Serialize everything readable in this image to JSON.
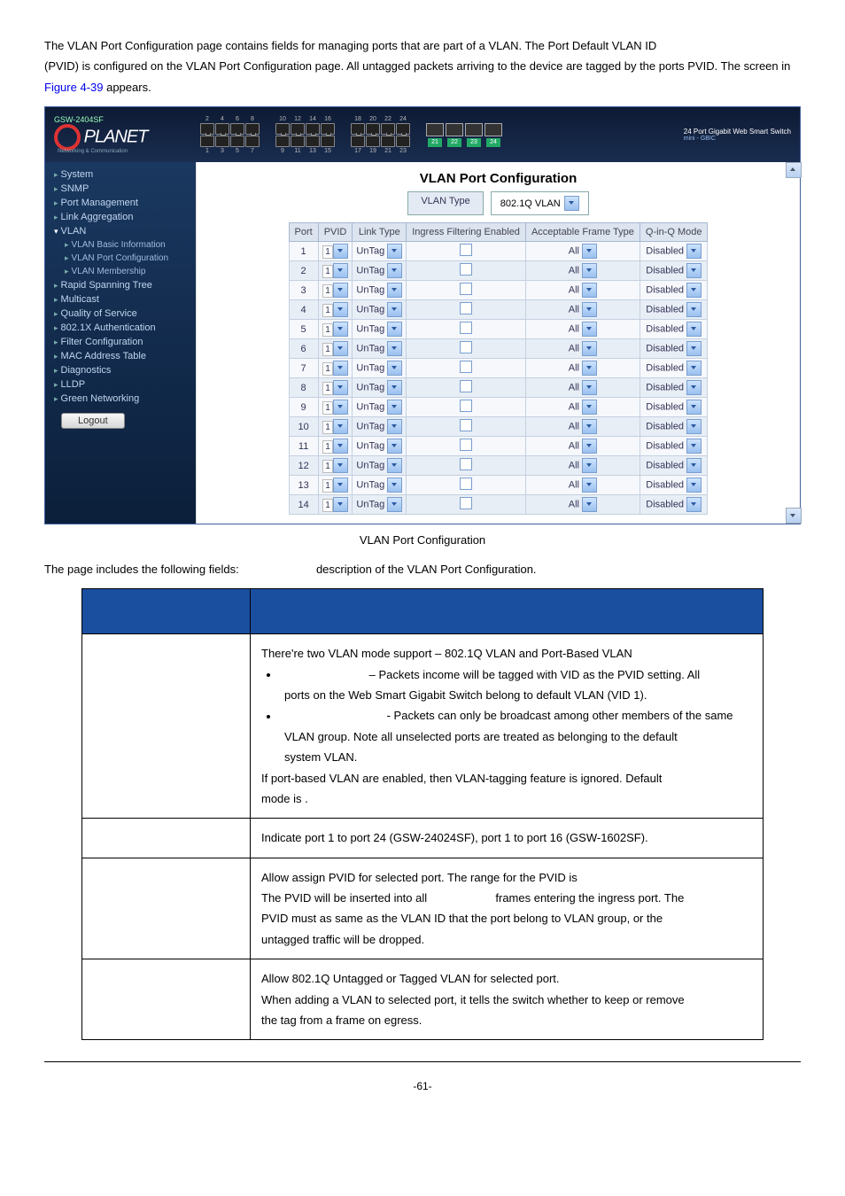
{
  "intro": {
    "p1": "The VLAN Port Configuration page contains fields for managing ports that are part of a VLAN. The Port Default VLAN ID",
    "p2a": "(PVID) is configured on the VLAN Port Configuration page. All untagged packets arriving to the device are tagged by the",
    "p2b": "ports PVID. The screen in ",
    "figlink": "Figure 4-39",
    "p2c": " appears."
  },
  "header": {
    "model": "GSW-2404SF",
    "brand": "PLANET",
    "brand_sub": "Networking & Communication",
    "title_r1": "24 Port Gigabit Web Smart Switch",
    "title_r2": "mini - GBIC",
    "top_port_nums": [
      "2",
      "4",
      "6",
      "8",
      "10",
      "12",
      "14",
      "16",
      "18",
      "20",
      "22",
      "24"
    ],
    "bot_port_nums": [
      "1",
      "3",
      "5",
      "7",
      "9",
      "11",
      "13",
      "15",
      "17",
      "19",
      "21",
      "23"
    ],
    "sfp_nums": [
      "21",
      "22",
      "23",
      "24"
    ]
  },
  "sidebar": {
    "items": [
      {
        "label": "System",
        "type": "top"
      },
      {
        "label": "SNMP",
        "type": "top"
      },
      {
        "label": "Port Management",
        "type": "top"
      },
      {
        "label": "Link Aggregation",
        "type": "top"
      },
      {
        "label": "VLAN",
        "type": "open"
      },
      {
        "label": "VLAN Basic Information",
        "type": "sub"
      },
      {
        "label": "VLAN Port Configuration",
        "type": "sub"
      },
      {
        "label": "VLAN Membership",
        "type": "sub"
      },
      {
        "label": "Rapid Spanning Tree",
        "type": "top"
      },
      {
        "label": "Multicast",
        "type": "top"
      },
      {
        "label": "Quality of Service",
        "type": "top"
      },
      {
        "label": "802.1X Authentication",
        "type": "top"
      },
      {
        "label": "Filter Configuration",
        "type": "top"
      },
      {
        "label": "MAC Address Table",
        "type": "top"
      },
      {
        "label": "Diagnostics",
        "type": "top"
      },
      {
        "label": "LLDP",
        "type": "top"
      },
      {
        "label": "Green Networking",
        "type": "top"
      }
    ],
    "logout": "Logout"
  },
  "main": {
    "title": "VLAN Port Configuration",
    "vlan_type_label": "VLAN Type",
    "vlan_type_value": "802.1Q VLAN",
    "columns": [
      "Port",
      "PVID",
      "Link Type",
      "Ingress Filtering Enabled",
      "Acceptable Frame Type",
      "Q-in-Q Mode"
    ],
    "rows": [
      {
        "port": "1",
        "pvid": "1",
        "link": "UnTag",
        "aft": "All",
        "qinq": "Disabled"
      },
      {
        "port": "2",
        "pvid": "1",
        "link": "UnTag",
        "aft": "All",
        "qinq": "Disabled"
      },
      {
        "port": "3",
        "pvid": "1",
        "link": "UnTag",
        "aft": "All",
        "qinq": "Disabled"
      },
      {
        "port": "4",
        "pvid": "1",
        "link": "UnTag",
        "aft": "All",
        "qinq": "Disabled"
      },
      {
        "port": "5",
        "pvid": "1",
        "link": "UnTag",
        "aft": "All",
        "qinq": "Disabled"
      },
      {
        "port": "6",
        "pvid": "1",
        "link": "UnTag",
        "aft": "All",
        "qinq": "Disabled"
      },
      {
        "port": "7",
        "pvid": "1",
        "link": "UnTag",
        "aft": "All",
        "qinq": "Disabled"
      },
      {
        "port": "8",
        "pvid": "1",
        "link": "UnTag",
        "aft": "All",
        "qinq": "Disabled"
      },
      {
        "port": "9",
        "pvid": "1",
        "link": "UnTag",
        "aft": "All",
        "qinq": "Disabled"
      },
      {
        "port": "10",
        "pvid": "1",
        "link": "UnTag",
        "aft": "All",
        "qinq": "Disabled"
      },
      {
        "port": "11",
        "pvid": "1",
        "link": "UnTag",
        "aft": "All",
        "qinq": "Disabled"
      },
      {
        "port": "12",
        "pvid": "1",
        "link": "UnTag",
        "aft": "All",
        "qinq": "Disabled"
      },
      {
        "port": "13",
        "pvid": "1",
        "link": "UnTag",
        "aft": "All",
        "qinq": "Disabled"
      },
      {
        "port": "14",
        "pvid": "1",
        "link": "UnTag",
        "aft": "All",
        "qinq": "Disabled"
      }
    ]
  },
  "caption": "VLAN Port Configuration",
  "desc_intro_a": "The page includes the following fields:",
  "desc_intro_b": "description of the VLAN Port Configuration.",
  "desc_table": {
    "vlan_type": {
      "l1": "There're two VLAN mode support – 802.1Q VLAN and Port-Based VLAN",
      "b1": " – Packets income will be tagged with VID as the PVID setting. All",
      "l2": "ports on the Web Smart Gigabit Switch belong to default VLAN (VID 1).",
      "b2": " - Packets can only be broadcast among other members of the same",
      "l3": "VLAN group. Note all unselected ports are treated as belonging to the default",
      "l4": "system VLAN.",
      "l5": "If port-based VLAN are enabled, then VLAN-tagging feature is ignored. Default",
      "l6": "mode is                    ."
    },
    "port": "Indicate port 1 to port 24 (GSW-24024SF), port 1 to port 16 (GSW-1602SF).",
    "pvid": {
      "l1": "Allow assign PVID for selected port. The range for the PVID is",
      "l2a": "The PVID will be inserted into all ",
      "l2b": " frames entering the ingress port. The",
      "l3": "PVID must as same as the VLAN ID that the port belong to VLAN group, or the",
      "l4": "untagged traffic will be dropped."
    },
    "link": {
      "l1": "Allow 802.1Q Untagged or Tagged VLAN for selected port.",
      "l2": "When adding a VLAN to selected port, it tells the switch whether to keep or remove",
      "l3": "the tag from a frame on egress."
    }
  },
  "page_num": "-61-"
}
